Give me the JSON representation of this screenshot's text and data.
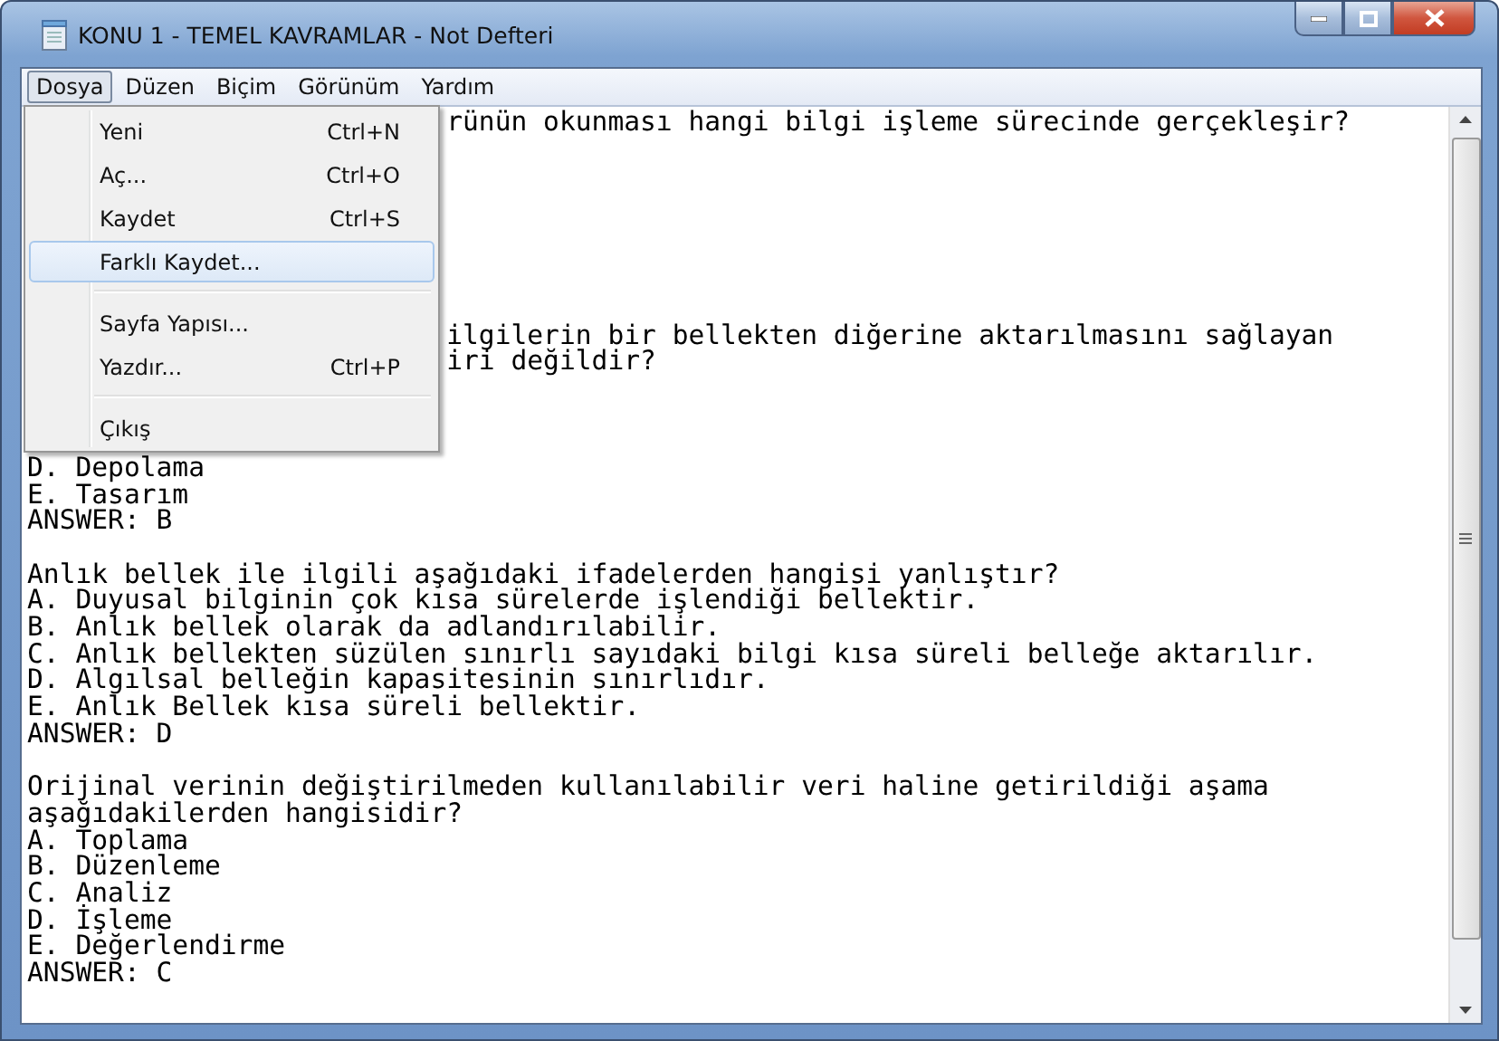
{
  "window": {
    "title": "KONU 1 - TEMEL KAVRAMLAR - Not Defteri"
  },
  "menu_bar": [
    {
      "label": "Dosya",
      "selected": true
    },
    {
      "label": "Düzen",
      "selected": false
    },
    {
      "label": "Biçim",
      "selected": false
    },
    {
      "label": "Görünüm",
      "selected": false
    },
    {
      "label": "Yardım",
      "selected": false
    }
  ],
  "open_menu": {
    "items": [
      {
        "kind": "item",
        "label": "Yeni",
        "shortcut": "Ctrl+N",
        "selected": false
      },
      {
        "kind": "item",
        "label": "Aç...",
        "shortcut": "Ctrl+O",
        "selected": false
      },
      {
        "kind": "item",
        "label": "Kaydet",
        "shortcut": "Ctrl+S",
        "selected": false
      },
      {
        "kind": "item",
        "label": "Farklı Kaydet...",
        "selected": true
      },
      {
        "kind": "separator"
      },
      {
        "kind": "item",
        "label": "Sayfa Yapısı...",
        "selected": false
      },
      {
        "kind": "item",
        "label": "Yazdır...",
        "shortcut": "Ctrl+P",
        "selected": false
      },
      {
        "kind": "separator"
      },
      {
        "kind": "item",
        "label": "Çıkış",
        "selected": false
      }
    ]
  },
  "editor": {
    "lines": [
      {
        "kind": "partial",
        "text": "rünün okunması hangi bilgi işleme sürecinde gerçekleşir?"
      },
      {
        "kind": "blank"
      },
      {
        "kind": "blank"
      },
      {
        "kind": "blank"
      },
      {
        "kind": "blank"
      },
      {
        "kind": "blank"
      },
      {
        "kind": "blank"
      },
      {
        "kind": "blank"
      },
      {
        "kind": "partial",
        "text": "ilgilerin bir bellekten diğerine aktarılmasını sağlayan"
      },
      {
        "kind": "partial",
        "text": "iri değildir?"
      },
      {
        "kind": "blank"
      },
      {
        "kind": "blank"
      },
      {
        "kind": "blank"
      },
      {
        "kind": "text",
        "text": "D. Depolama"
      },
      {
        "kind": "text",
        "text": "E. Tasarım"
      },
      {
        "kind": "text",
        "text": "ANSWER: B"
      },
      {
        "kind": "blank"
      },
      {
        "kind": "text",
        "text": "Anlık bellek ile ilgili aşağıdaki ifadelerden hangisi yanlıştır?"
      },
      {
        "kind": "text",
        "text": "A. Duyusal bilginin çok kısa sürelerde işlendiği bellektir."
      },
      {
        "kind": "text",
        "text": "B. Anlık bellek olarak da adlandırılabilir."
      },
      {
        "kind": "text",
        "text": "C. Anlık bellekten süzülen sınırlı sayıdaki bilgi kısa süreli belleğe aktarılır."
      },
      {
        "kind": "text",
        "text": "D. Algılsal belleğin kapasitesinin sınırlıdır."
      },
      {
        "kind": "text",
        "text": "E. Anlık Bellek kısa süreli bellektir."
      },
      {
        "kind": "text",
        "text": "ANSWER: D"
      },
      {
        "kind": "blank"
      },
      {
        "kind": "text",
        "text": "Orijinal verinin değiştirilmeden kullanılabilir veri haline getirildiği aşama"
      },
      {
        "kind": "text",
        "text": "aşağıdakilerden hangisidir?"
      },
      {
        "kind": "text",
        "text": "A. Toplama"
      },
      {
        "kind": "text",
        "text": "B. Düzenleme"
      },
      {
        "kind": "text",
        "text": "C. Analiz"
      },
      {
        "kind": "text",
        "text": "D. İşleme"
      },
      {
        "kind": "text",
        "text": "E. Değerlendirme"
      },
      {
        "kind": "text",
        "text": "ANSWER: C"
      }
    ]
  }
}
